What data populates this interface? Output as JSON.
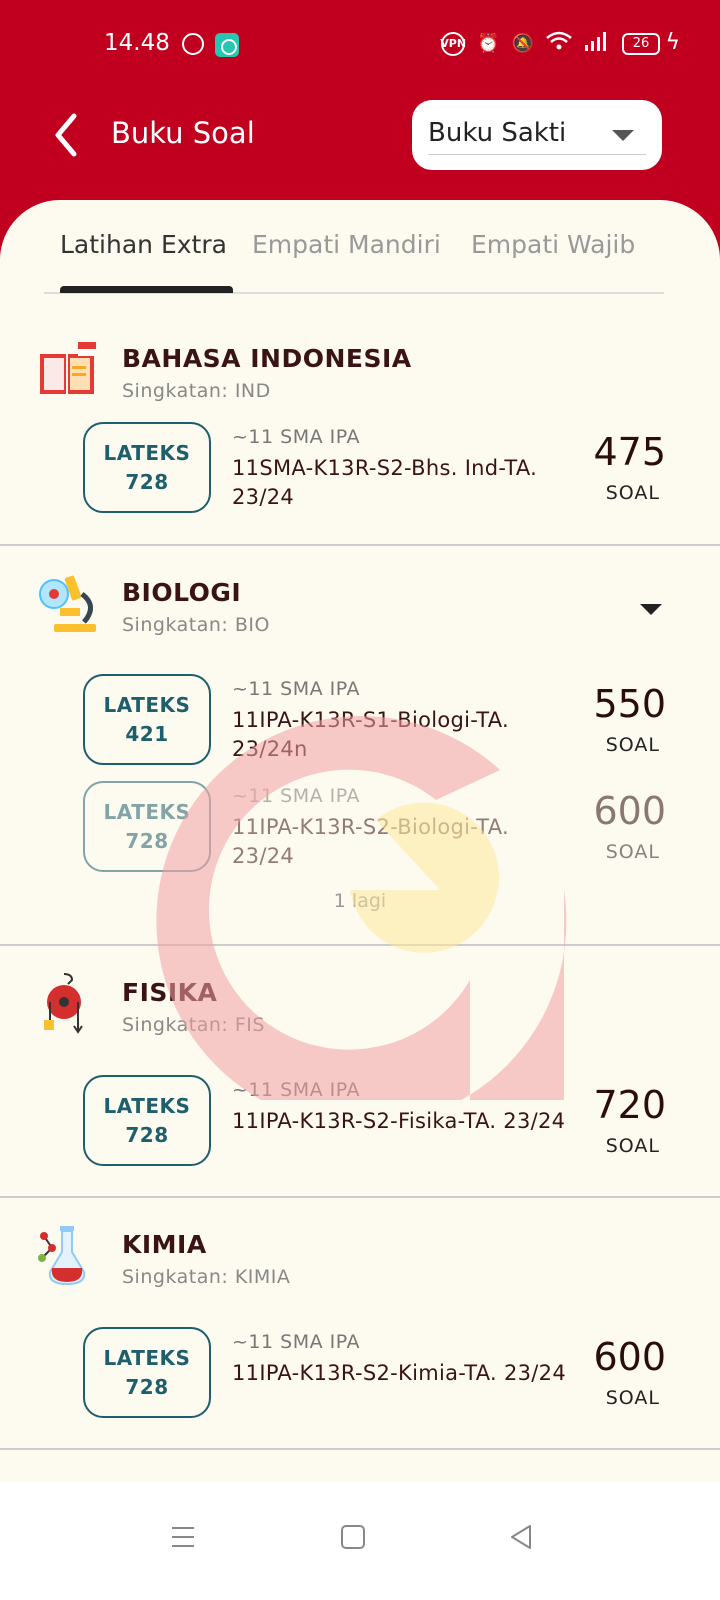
{
  "status_bar": {
    "time": "14.48",
    "vpn": "VPN",
    "battery": "26"
  },
  "header": {
    "title": "Buku Soal",
    "selector_value": "Buku Sakti"
  },
  "tabs": [
    {
      "label": "Latihan Extra",
      "active": true
    },
    {
      "label": "Empati Mandiri",
      "active": false
    },
    {
      "label": "Empati Wajib",
      "active": false
    }
  ],
  "subjects": [
    {
      "name": "BAHASA INDONESIA",
      "abbr": "Singkatan: IND",
      "icon": "book-icon",
      "items": [
        {
          "badge_label": "LATEKS",
          "badge_number": "728",
          "level": "~11 SMA IPA",
          "code": "11SMA-K13R-S2-Bhs. Ind-TA. 23/24",
          "count": "475",
          "unit": "SOAL"
        }
      ]
    },
    {
      "name": "BIOLOGI",
      "abbr": "Singkatan: BIO",
      "icon": "microscope-icon",
      "items": [
        {
          "badge_label": "LATEKS",
          "badge_number": "421",
          "level": "~11 SMA IPA",
          "code": "11IPA-K13R-S1-Biologi-TA. 23/24n",
          "count": "550",
          "unit": "SOAL"
        },
        {
          "badge_label": "LATEKS",
          "badge_number": "728",
          "level": "~11 SMA IPA",
          "code": "11IPA-K13R-S2-Biologi-TA. 23/24",
          "count": "600",
          "unit": "SOAL"
        }
      ],
      "more_label": "1 lagi"
    },
    {
      "name": "FISIKA",
      "abbr": "Singkatan: FIS",
      "icon": "physics-pulley-icon",
      "items": [
        {
          "badge_label": "LATEKS",
          "badge_number": "728",
          "level": "~11 SMA IPA",
          "code": "11IPA-K13R-S2-Fisika-TA. 23/24",
          "count": "720",
          "unit": "SOAL"
        }
      ]
    },
    {
      "name": "KIMIA",
      "abbr": "Singkatan: KIMIA",
      "icon": "flask-icon",
      "items": [
        {
          "badge_label": "LATEKS",
          "badge_number": "728",
          "level": "~11 SMA IPA",
          "code": "11IPA-K13R-S2-Kimia-TA. 23/24",
          "count": "600",
          "unit": "SOAL"
        }
      ]
    }
  ],
  "colors": {
    "brand_red": "#c1001f",
    "sheet_bg": "#fdfaef",
    "badge_teal": "#1e5f6e",
    "title_dark": "#3a1414"
  }
}
